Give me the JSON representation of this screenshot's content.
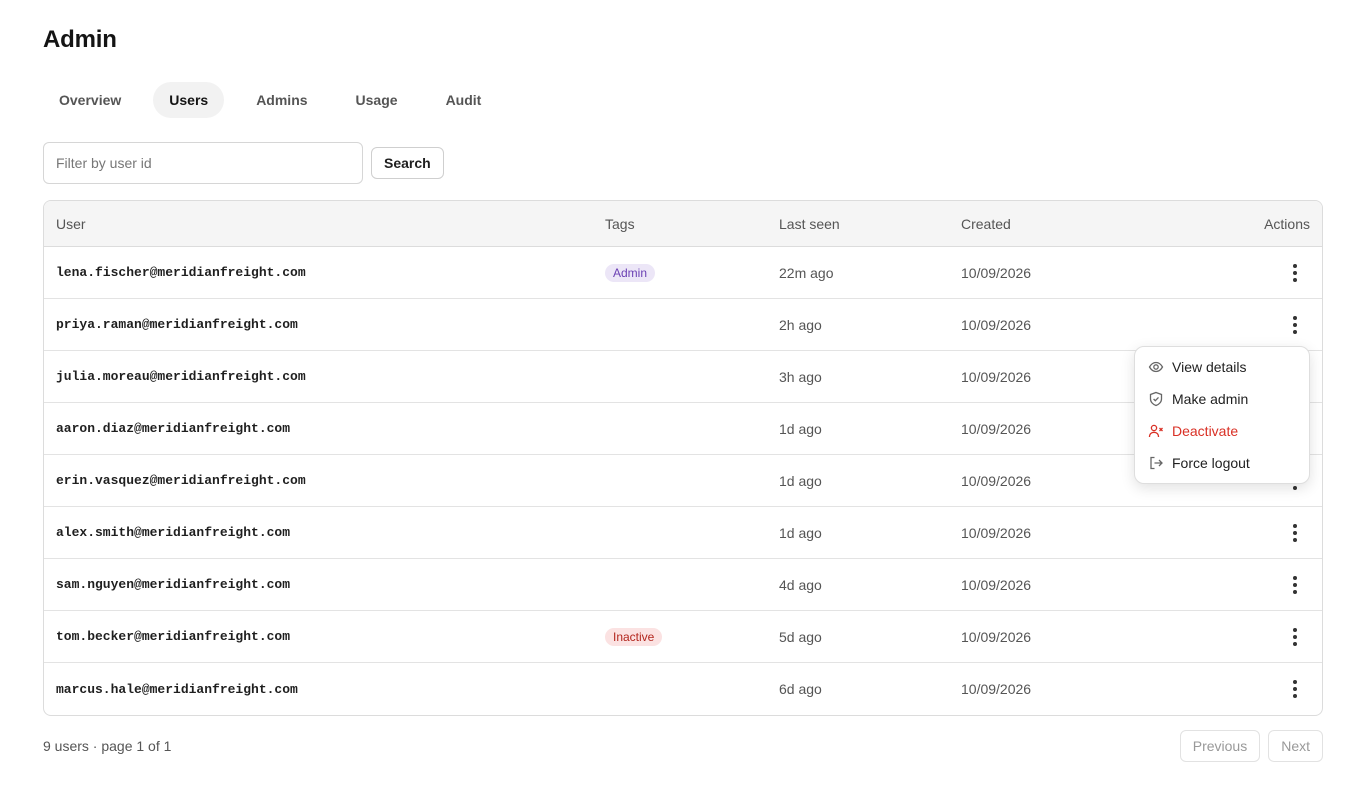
{
  "page": {
    "title": "Admin"
  },
  "tabs": [
    {
      "label": "Overview",
      "active": false
    },
    {
      "label": "Users",
      "active": true
    },
    {
      "label": "Admins",
      "active": false
    },
    {
      "label": "Usage",
      "active": false
    },
    {
      "label": "Audit",
      "active": false
    }
  ],
  "filter": {
    "placeholder": "Filter by user id",
    "value": "",
    "search_label": "Search"
  },
  "table": {
    "headers": {
      "user": "User",
      "tags": "Tags",
      "last_seen": "Last seen",
      "created": "Created",
      "actions": "Actions"
    },
    "rows": [
      {
        "user": "lena.fischer@meridianfreight.com",
        "tag": "Admin",
        "tag_kind": "admin",
        "last_seen": "22m ago",
        "created": "10/09/2026"
      },
      {
        "user": "priya.raman@meridianfreight.com",
        "tag": "",
        "tag_kind": "",
        "last_seen": "2h ago",
        "created": "10/09/2026"
      },
      {
        "user": "julia.moreau@meridianfreight.com",
        "tag": "",
        "tag_kind": "",
        "last_seen": "3h ago",
        "created": "10/09/2026"
      },
      {
        "user": "aaron.diaz@meridianfreight.com",
        "tag": "",
        "tag_kind": "",
        "last_seen": "1d ago",
        "created": "10/09/2026"
      },
      {
        "user": "erin.vasquez@meridianfreight.com",
        "tag": "",
        "tag_kind": "",
        "last_seen": "1d ago",
        "created": "10/09/2026"
      },
      {
        "user": "alex.smith@meridianfreight.com",
        "tag": "",
        "tag_kind": "",
        "last_seen": "1d ago",
        "created": "10/09/2026"
      },
      {
        "user": "sam.nguyen@meridianfreight.com",
        "tag": "",
        "tag_kind": "",
        "last_seen": "4d ago",
        "created": "10/09/2026"
      },
      {
        "user": "tom.becker@meridianfreight.com",
        "tag": "Inactive",
        "tag_kind": "inactive",
        "last_seen": "5d ago",
        "created": "10/09/2026"
      },
      {
        "user": "marcus.hale@meridianfreight.com",
        "tag": "",
        "tag_kind": "",
        "last_seen": "6d ago",
        "created": "10/09/2026"
      }
    ]
  },
  "action_menu": {
    "open_for_row": 1,
    "items": [
      {
        "label": "View details",
        "icon": "eye-icon",
        "danger": false
      },
      {
        "label": "Make admin",
        "icon": "shield-icon",
        "danger": false
      },
      {
        "label": "Deactivate",
        "icon": "user-x-icon",
        "danger": true
      },
      {
        "label": "Force logout",
        "icon": "logout-icon",
        "danger": false
      }
    ]
  },
  "footer": {
    "count_text": "9 users · page 1 of 1",
    "previous_label": "Previous",
    "next_label": "Next"
  },
  "colors": {
    "admin_tag_bg": "#ece6f7",
    "admin_tag_text": "#6a3fb3",
    "inactive_tag_bg": "#fbe2e2",
    "inactive_tag_text": "#b3261e",
    "danger": "#d93025"
  }
}
